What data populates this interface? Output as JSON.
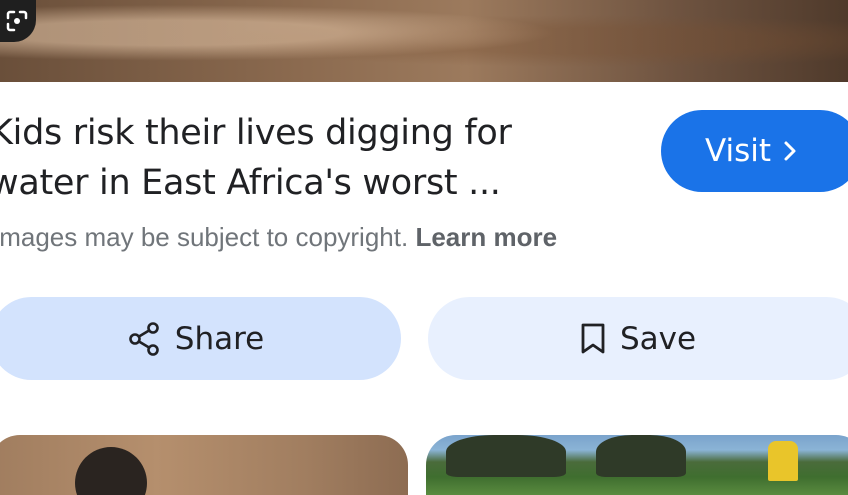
{
  "result": {
    "title_lines": [
      "Kids risk their lives digging for",
      "water in East Africa's worst ..."
    ]
  },
  "actions": {
    "visit_label": "Visit",
    "share_label": "Share",
    "save_label": "Save"
  },
  "notice": {
    "text": "Images may be subject to copyright.",
    "link_label": "Learn more"
  },
  "icons": {
    "lens": "lens-icon",
    "visit": "chevron-right-icon",
    "share": "share-icon",
    "save": "bookmark-icon"
  },
  "colors": {
    "primary": "#1a73e8",
    "share_bg": "#d3e3fd",
    "save_bg": "#e8f0fe",
    "text": "#202124",
    "muted": "#70757a"
  }
}
